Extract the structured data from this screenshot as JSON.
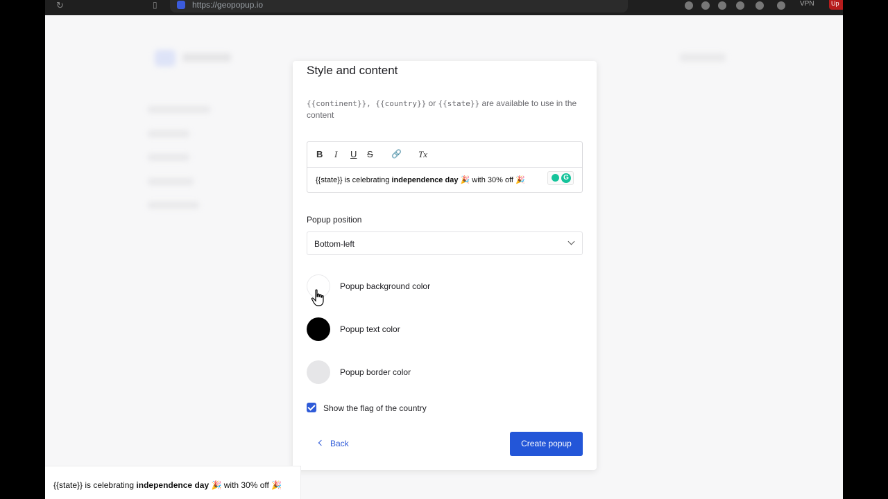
{
  "browser": {
    "url": "https://geopopup.io",
    "vpn_label": "VPN",
    "update_label": "Up"
  },
  "card": {
    "title": "Style and content",
    "hint_vars": "{{continent}}, {{country}}",
    "hint_or": " or ",
    "hint_state": "{{state}}",
    "hint_rest": " are available to use in the content"
  },
  "editor": {
    "toolbar": {
      "bold": "B",
      "italic": "I",
      "underline": "U",
      "strike": "S",
      "link": "🔗",
      "clear": "Tx"
    },
    "content_pre": "{{state}} is celebrating ",
    "content_bold": "independence day",
    "content_post": " 🎉 with 30% off 🎉"
  },
  "position": {
    "label": "Popup position",
    "value": "Bottom-left"
  },
  "colors": {
    "background_label": "Popup background color",
    "background_value": "#ffffff",
    "text_label": "Popup text color",
    "text_value": "#000000",
    "border_label": "Popup border color",
    "border_value": "#e6e6e8"
  },
  "flag": {
    "label": "Show the flag of the country",
    "checked": true
  },
  "actions": {
    "back_label": "Back",
    "create_label": "Create popup"
  },
  "preview": {
    "text_pre": "{{state}} is celebrating ",
    "text_bold": "independence day",
    "text_post": " 🎉 with 30% off 🎉"
  },
  "accent_color": "#2356d8"
}
